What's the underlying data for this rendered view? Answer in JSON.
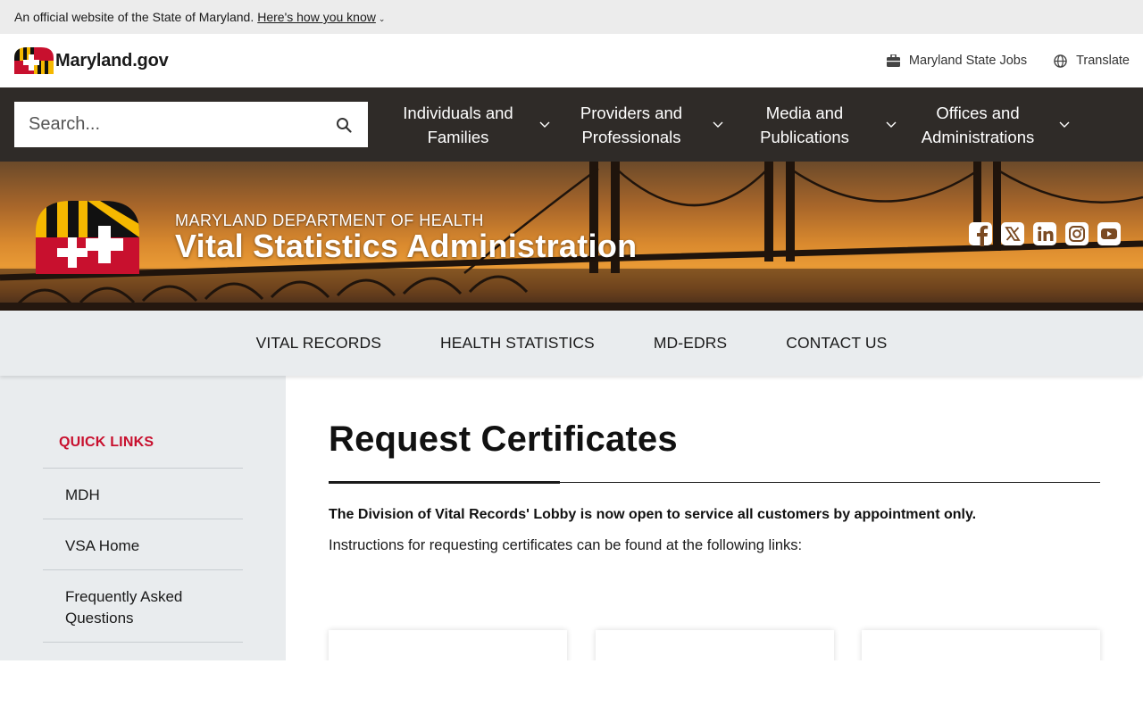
{
  "official_banner": {
    "text": "An official website of the State of Maryland.",
    "link": "Here's how you know"
  },
  "header": {
    "brand": "Maryland.gov",
    "utility": [
      {
        "label": "Maryland State Jobs",
        "icon": "briefcase-icon"
      },
      {
        "label": "Translate",
        "icon": "globe-icon"
      }
    ]
  },
  "search": {
    "placeholder": "Search..."
  },
  "main_nav": [
    {
      "label": "Individuals and Families"
    },
    {
      "label": "Providers and Professionals"
    },
    {
      "label": "Media and Publications"
    },
    {
      "label": "Offices and Administrations"
    }
  ],
  "hero": {
    "department": "MARYLAND DEPARTMENT OF HEALTH",
    "title": "Vital Statistics Administration",
    "social": [
      "facebook-icon",
      "x-icon",
      "linkedin-icon",
      "instagram-icon",
      "youtube-icon"
    ]
  },
  "sub_nav": [
    "VITAL RECORDS",
    "HEALTH STATISTICS",
    "MD-EDRS",
    "CONTACT US"
  ],
  "sidebar": {
    "title": "QUICK LINKS",
    "items": [
      "MDH",
      "VSA Home",
      "Frequently Asked Questions"
    ]
  },
  "main": {
    "title": "Request Certificates",
    "notice": "The Division of Vital Records' Lobby is now open to service all customers by appointment only.",
    "instructions": "Instructions for requesting certificates can be found at the following links:"
  },
  "colors": {
    "accent_red": "#c8102e",
    "nav_bg": "#2f2b28",
    "light_bg": "#e9ecee"
  }
}
